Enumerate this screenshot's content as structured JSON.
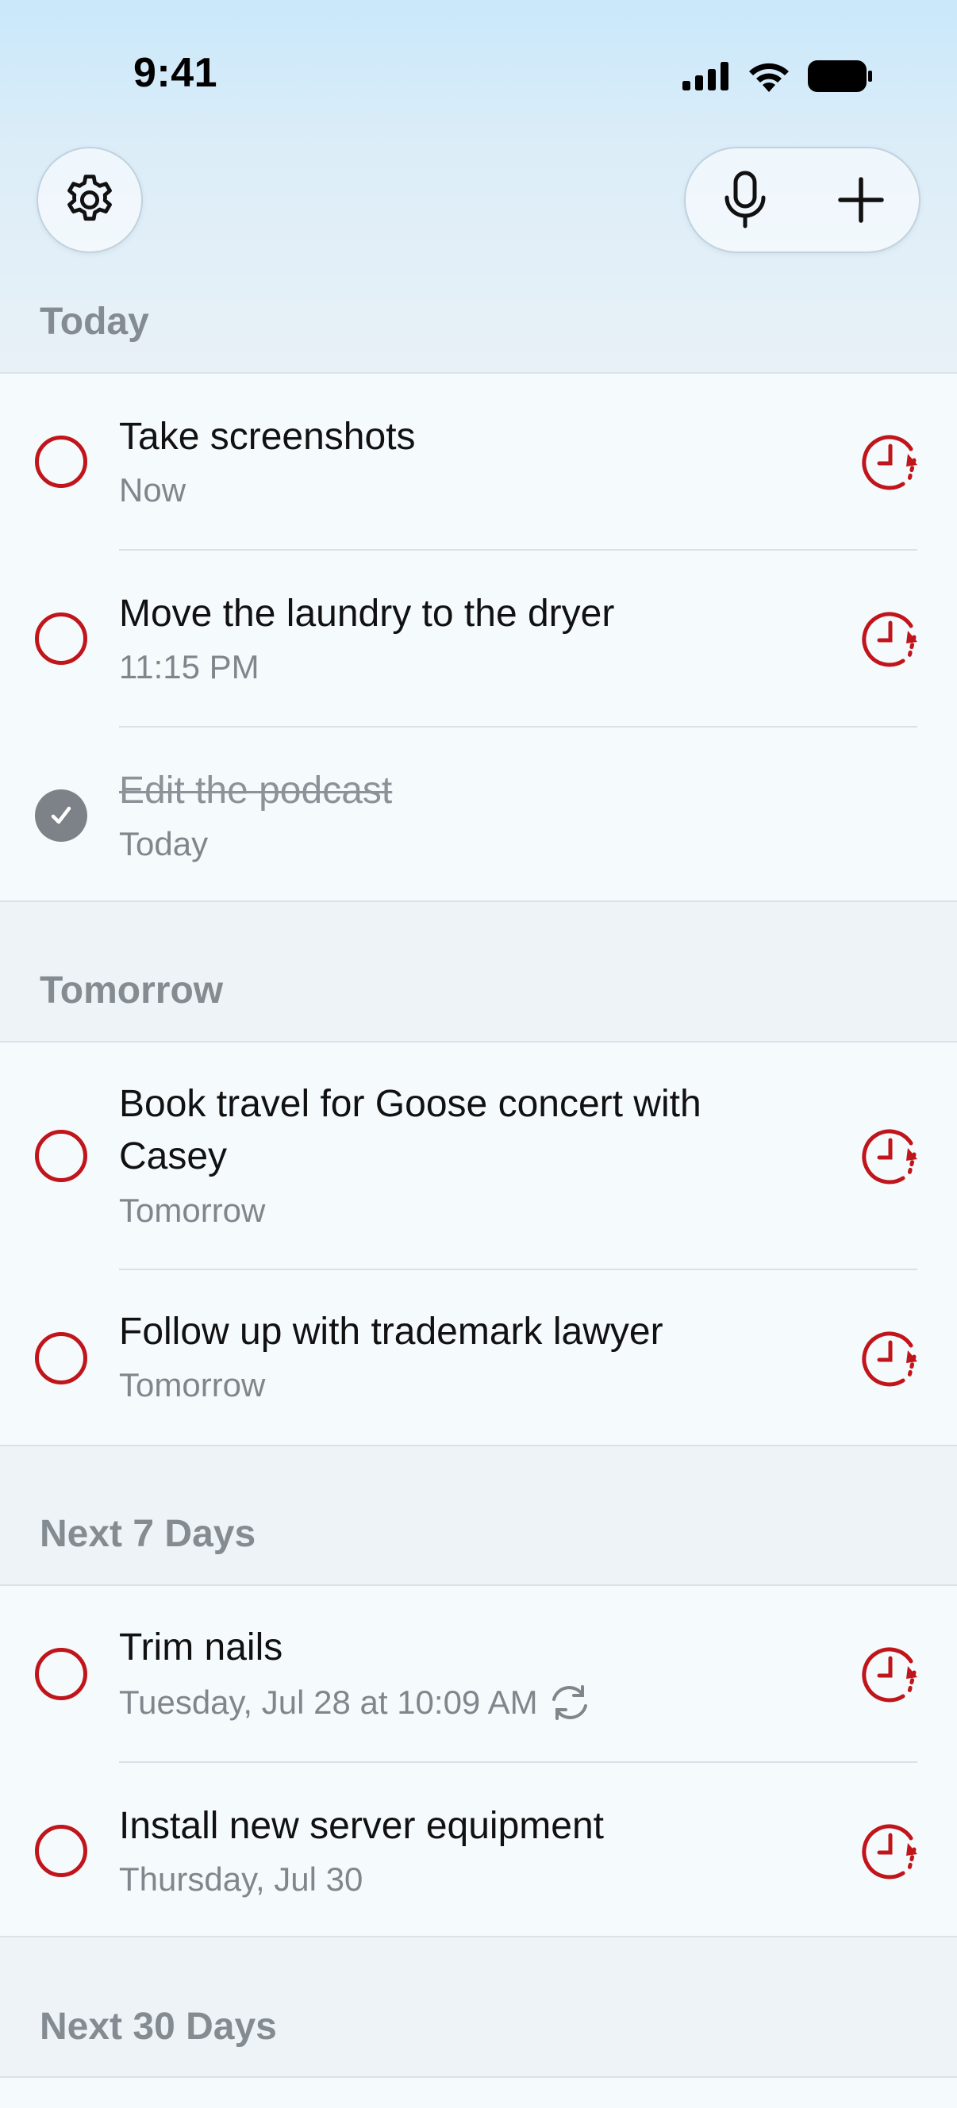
{
  "status_bar": {
    "time": "9:41"
  },
  "colors": {
    "accent": "#c0151b",
    "completed": "#7c8287",
    "header_text": "#848b91"
  },
  "toolbar": {
    "settings_icon": "gear-icon",
    "mic_icon": "microphone-icon",
    "add_icon": "plus-icon"
  },
  "sections": [
    {
      "title": "Today",
      "items": [
        {
          "title": "Take screenshots",
          "subtitle": "Now",
          "completed": false
        },
        {
          "title": "Move the laundry to the dryer",
          "subtitle": "11:15 PM",
          "completed": false
        },
        {
          "title": "Edit the podcast",
          "subtitle": "Today",
          "completed": true
        }
      ]
    },
    {
      "title": "Tomorrow",
      "items": [
        {
          "title": "Book travel for Goose concert with Casey",
          "subtitle": "Tomorrow",
          "completed": false
        },
        {
          "title": "Follow up with trademark lawyer",
          "subtitle": "Tomorrow",
          "completed": false
        }
      ]
    },
    {
      "title": "Next 7 Days",
      "items": [
        {
          "title": "Trim nails",
          "subtitle": "Tuesday, Jul 28 at 10:09 AM",
          "repeat": true,
          "completed": false
        },
        {
          "title": "Install new server equipment",
          "subtitle": "Thursday, Jul 30",
          "completed": false
        }
      ]
    },
    {
      "title": "Next 30 Days",
      "items": []
    }
  ]
}
